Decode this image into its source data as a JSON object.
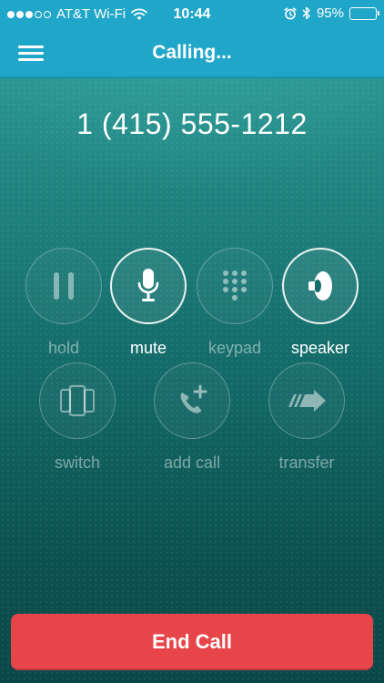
{
  "status_bar": {
    "carrier": "AT&T Wi-Fi",
    "time": "10:44",
    "battery_percent": "95%",
    "battery_level": 0.95,
    "signal_bars_filled": 3,
    "signal_bars_total": 5
  },
  "nav": {
    "title": "Calling...",
    "menu_icon": "hamburger-menu-icon"
  },
  "call": {
    "phone_number": "1 (415) 555-1212"
  },
  "controls": {
    "row1": [
      {
        "id": "hold",
        "label": "hold",
        "icon": "pause-icon",
        "active": false
      },
      {
        "id": "mute",
        "label": "mute",
        "icon": "microphone-icon",
        "active": true
      },
      {
        "id": "keypad",
        "label": "keypad",
        "icon": "keypad-icon",
        "active": false
      },
      {
        "id": "speaker",
        "label": "speaker",
        "icon": "speaker-icon",
        "active": true
      }
    ],
    "row2": [
      {
        "id": "switch",
        "label": "switch",
        "icon": "switch-devices-icon",
        "active": false
      },
      {
        "id": "add-call",
        "label": "add call",
        "icon": "add-call-icon",
        "active": false
      },
      {
        "id": "transfer",
        "label": "transfer",
        "icon": "transfer-arrow-icon",
        "active": false
      }
    ]
  },
  "end_call": {
    "label": "End Call"
  },
  "colors": {
    "header": "#20a6c8",
    "end_call": "#e8454a",
    "background_top": "#2e9a96",
    "background_bottom": "#0a4847"
  }
}
